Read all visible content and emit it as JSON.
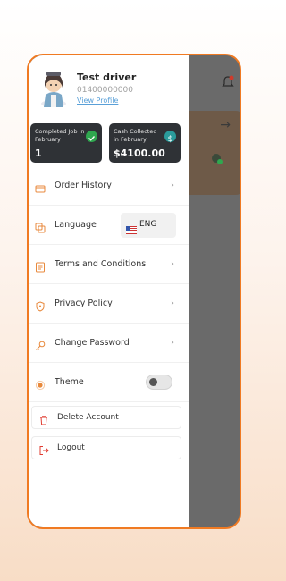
{
  "profile": {
    "name": "Test driver",
    "phone": "01400000000",
    "view_profile_label": "View Profile"
  },
  "stats": {
    "completed": {
      "label": "Completed Job in February",
      "value": "1"
    },
    "cash": {
      "label": "Cash Collected in February",
      "value": "$4100.00"
    }
  },
  "menu": {
    "order_history": "Order History",
    "language": "Language",
    "terms": "Terms and Conditions",
    "privacy": "Privacy Policy",
    "change_password": "Change Password",
    "theme": "Theme"
  },
  "language_selector": {
    "code": "ENG",
    "flag": "us-flag-icon"
  },
  "theme_toggle": {
    "on": false
  },
  "actions": {
    "delete_account": "Delete Account",
    "logout": "Logout"
  },
  "colors": {
    "accent": "#f07a22",
    "delete_red": "#e03c31",
    "card_dark": "#2f3236"
  }
}
